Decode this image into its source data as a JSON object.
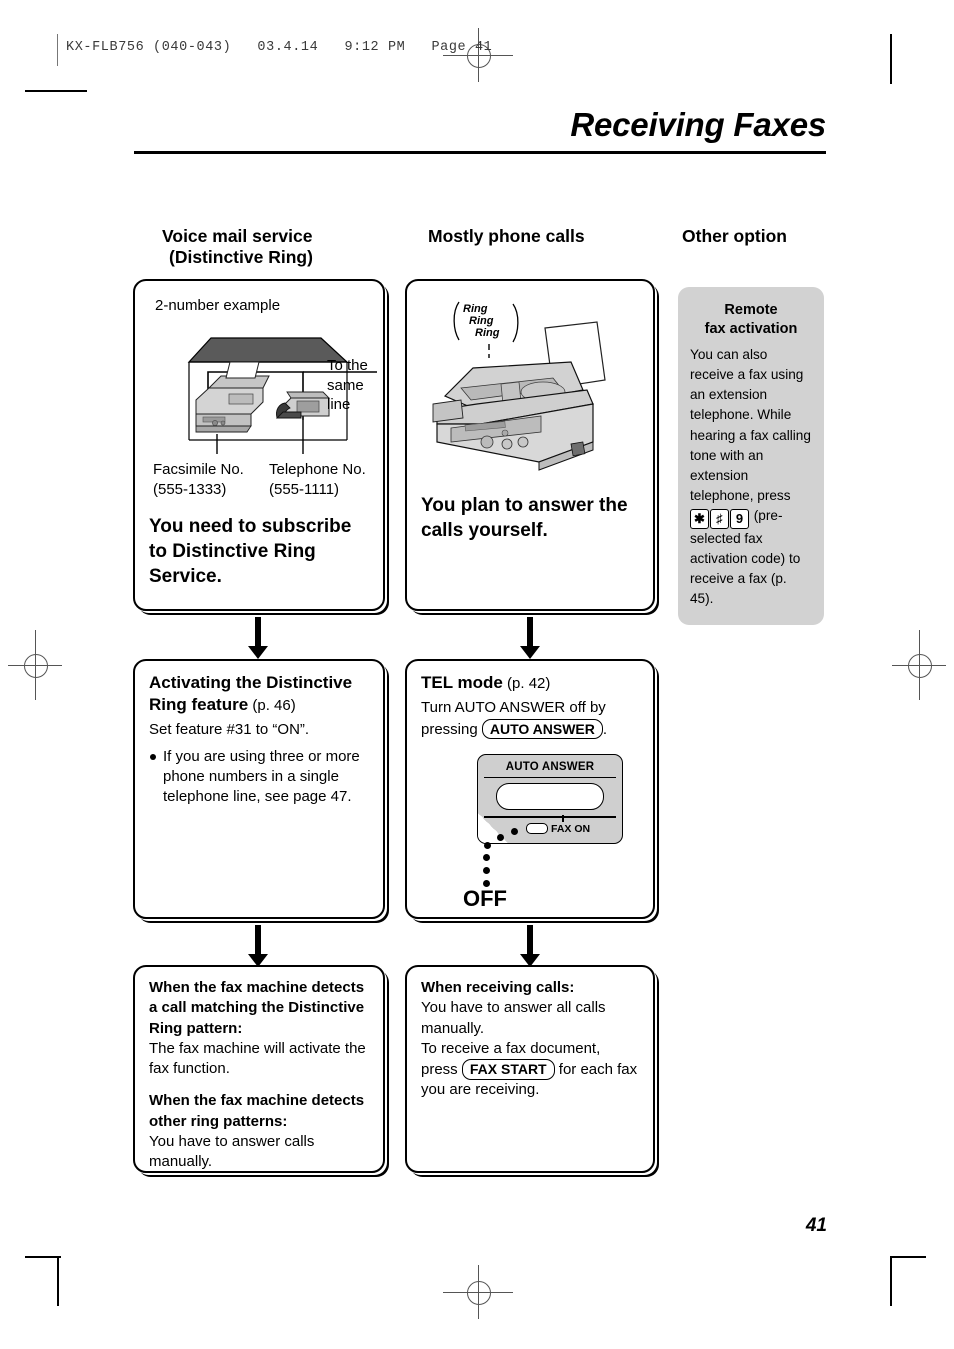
{
  "print_slug": "KX-FLB756 (040-043)   03.4.14   9:12 PM   Page 41",
  "page_title": "Receiving Faxes",
  "page_number": "41",
  "columns": [
    {
      "heading_line1": "Voice mail service",
      "heading_line2": "(Distinctive Ring)"
    },
    {
      "heading_line1": "Mostly phone calls",
      "heading_line2": ""
    },
    {
      "heading_line1": "Other option",
      "heading_line2": ""
    }
  ],
  "col1": {
    "box1": {
      "caption": "2-number example",
      "to_same_line_1": "To the",
      "to_same_line_2": "same line",
      "fax_label": "Facsimile No.",
      "fax_number": "(555-1333)",
      "tel_label": "Telephone No.",
      "tel_number": "(555-1111)",
      "statement": "You need to subscribe to Distinctive Ring Service."
    },
    "box2": {
      "heading_bold": "Activating the Distinctive Ring feature",
      "heading_page": " (p. 46)",
      "body": "Set feature #31 to “ON”.",
      "bullet": "If you are using three or more phone numbers in a single telephone line, see page 47."
    },
    "box3": {
      "head1": "When the fax machine detects a call matching the Distinctive Ring pattern:",
      "body1": "The fax machine will activate the fax function.",
      "head2": "When the fax machine detects other ring patterns:",
      "body2": "You have to answer calls manually."
    }
  },
  "col2": {
    "box1": {
      "ring_sound": "Ring Ring Ring",
      "ring_line1": "Ring",
      "ring_line2": "Ring",
      "ring_line3": "Ring",
      "statement": "You plan to answer the calls yourself."
    },
    "box2": {
      "heading_bold": "TEL mode",
      "heading_page": " (p. 42)",
      "body_pre": "Turn AUTO ANSWER off by pressing ",
      "key_label": "AUTO ANSWER",
      "body_post": ".",
      "panel_title": "AUTO ANSWER",
      "panel_led_label": "FAX ON",
      "off_label": "OFF"
    },
    "box3": {
      "head1": "When receiving calls:",
      "body1": "You have to answer all calls manually.",
      "body2_pre": "To receive a fax document, press ",
      "key_label": "FAX START",
      "body2_post": " for each fax you are receiving."
    }
  },
  "sidebar": {
    "title_line1": "Remote",
    "title_line2": "fax activation",
    "text_pre": "You can also receive a fax using an extension telephone. While hearing a fax calling tone with an extension telephone, press ",
    "key1": "✱",
    "key2": "♯",
    "key3": "9",
    "text_post": " (pre-selected fax activation code) to receive a fax (p. 45)."
  }
}
